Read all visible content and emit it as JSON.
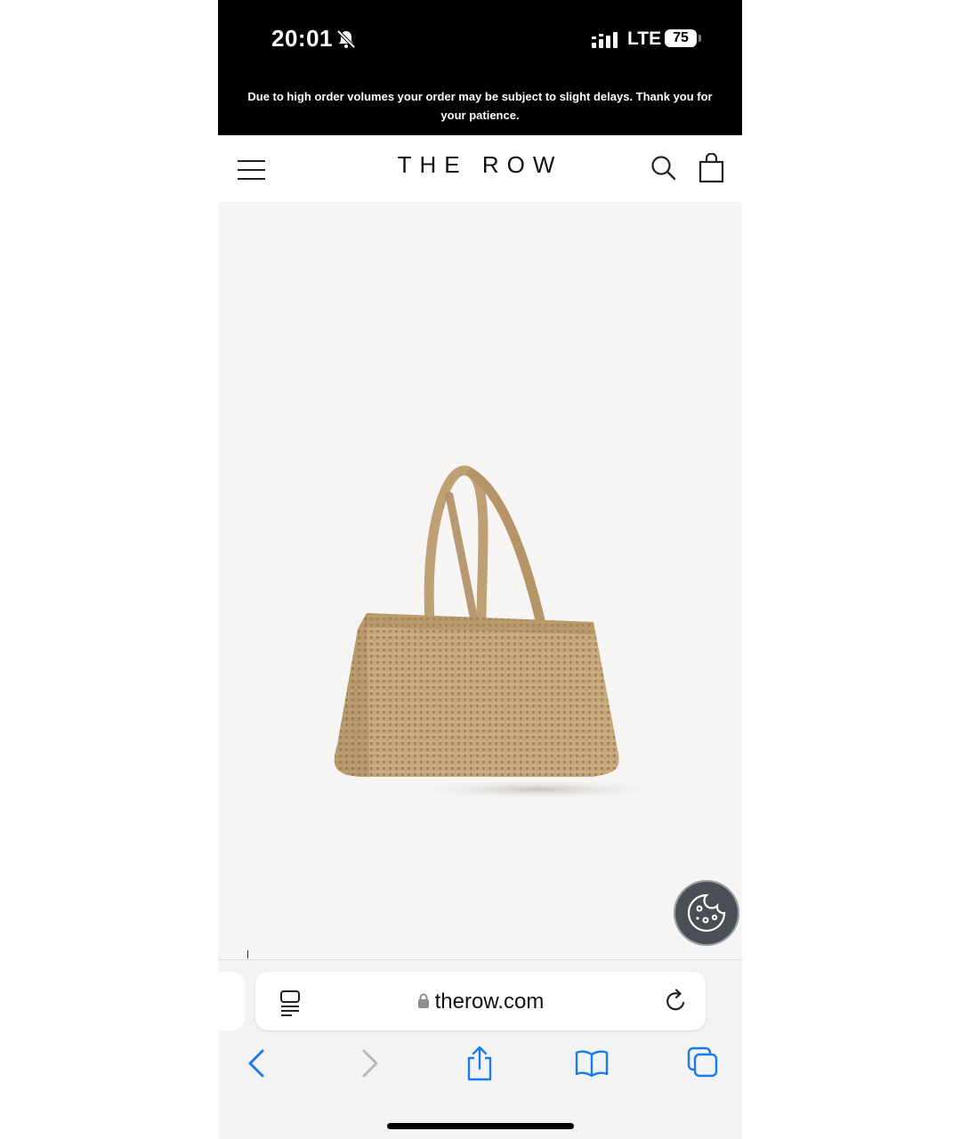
{
  "status_bar": {
    "time": "20:01",
    "network": "LTE",
    "battery": "75"
  },
  "banner": {
    "text": "Due to high order volumes your order may be subject to slight delays. Thank you for your patience."
  },
  "header": {
    "logo": "THE ROW",
    "icons": [
      "menu-icon",
      "search-icon",
      "shopping-bag-icon"
    ]
  },
  "product": {
    "image_subject": "woven raffia tote bag",
    "colors": {
      "background": "#f6f5f4",
      "bag": "#c4a57a"
    }
  },
  "safari": {
    "url": "therow.com",
    "icons": [
      "reader-icon",
      "lock-icon",
      "reload-icon",
      "back-icon",
      "forward-icon",
      "share-icon",
      "bookmarks-icon",
      "tabs-icon"
    ],
    "colors": {
      "accent": "#1a7bf0",
      "disabled": "#b7b7bb"
    }
  }
}
